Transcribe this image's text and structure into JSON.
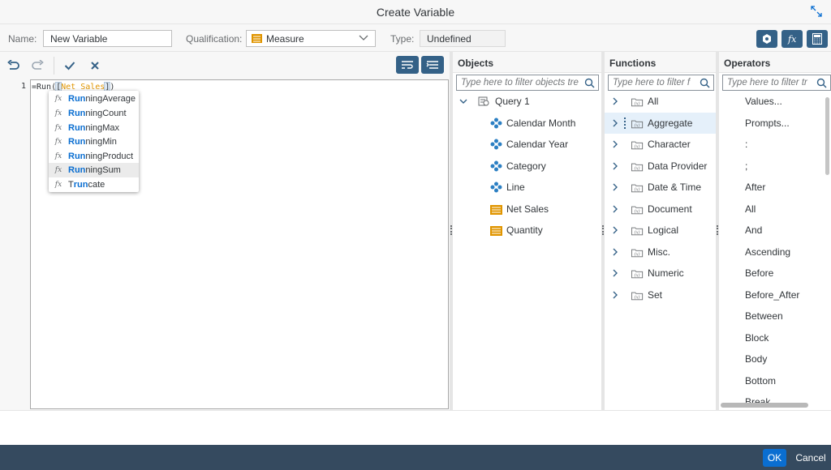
{
  "dialog": {
    "title": "Create Variable"
  },
  "props": {
    "name_label": "Name:",
    "name_value": "New Variable",
    "qualification_label": "Qualification:",
    "qualification_value": "Measure",
    "type_label": "Type:",
    "type_value": "Undefined"
  },
  "editor": {
    "line_number": "1",
    "code_prefix": "=Run(",
    "code_open": "[",
    "code_object": "Net Sales",
    "code_close": "]",
    "code_paren": ")"
  },
  "autocomplete": [
    {
      "match": "Run",
      "rest": "ningAverage"
    },
    {
      "match": "Run",
      "rest": "ningCount"
    },
    {
      "match": "Run",
      "rest": "ningMax"
    },
    {
      "match": "Run",
      "rest": "ningMin"
    },
    {
      "match": "Run",
      "rest": "ningProduct"
    },
    {
      "match": "Run",
      "rest": "ningSum"
    },
    {
      "match": "",
      "pre": "T",
      "mid": "run",
      "rest": "cate"
    }
  ],
  "objects": {
    "header": "Objects",
    "search_placeholder": "Type here to filter objects tre",
    "query": "Query 1",
    "items": [
      {
        "label": "Calendar Month",
        "kind": "dimension"
      },
      {
        "label": "Calendar Year",
        "kind": "dimension"
      },
      {
        "label": "Category",
        "kind": "dimension"
      },
      {
        "label": "Line",
        "kind": "dimension"
      },
      {
        "label": "Net Sales",
        "kind": "measure"
      },
      {
        "label": "Quantity",
        "kind": "measure"
      }
    ]
  },
  "functions": {
    "header": "Functions",
    "search_placeholder": "Type here to filter f",
    "items": [
      "All",
      "Aggregate",
      "Character",
      "Data Provider",
      "Date & Time",
      "Document",
      "Logical",
      "Misc.",
      "Numeric",
      "Set"
    ]
  },
  "operators": {
    "header": "Operators",
    "search_placeholder": "Type here to filter tr",
    "items": [
      "Values...",
      "Prompts...",
      ":",
      ";",
      "After",
      "All",
      "And",
      "Ascending",
      "Before",
      "Before_After",
      "Between",
      "Block",
      "Body",
      "Bottom",
      "Break"
    ]
  },
  "footer": {
    "ok_label": "OK",
    "cancel_label": "Cancel"
  },
  "colors": {
    "accent": "#0a6ed1",
    "button_dark": "#346187",
    "footer": "#354a5f",
    "measure": "#e09500",
    "dimension": "#2b7fc3"
  },
  "icons": [
    "expand-icon",
    "dropdown-icon",
    "cube-icon",
    "function-icon",
    "calculator-icon",
    "undo-icon",
    "redo-icon",
    "check-icon",
    "close-icon",
    "wrap-icon",
    "format-icon",
    "search-icon",
    "chevron-right-icon",
    "chevron-down-icon",
    "query-icon",
    "dimension-icon",
    "measure-icon",
    "function-folder-icon"
  ]
}
